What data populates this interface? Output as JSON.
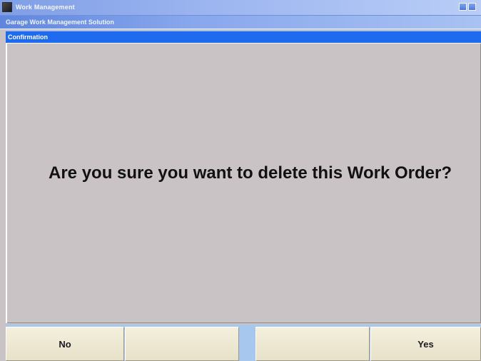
{
  "window": {
    "title": "Work Management",
    "subtitle": "Garage Work Management Solution"
  },
  "dialog": {
    "title": "Confirmation",
    "message": "Are you sure you want to delete this Work Order?"
  },
  "softkeys": [
    {
      "label": "No"
    },
    {
      "label": ""
    },
    {
      "label": ""
    },
    {
      "label": "Yes"
    }
  ],
  "colors": {
    "dialog_title_bg": "#1e6bf0",
    "body_bg": "#c9c3c6",
    "softkey_bg": "#efe9d3",
    "strip_bg": "#a7c7ef"
  },
  "icons": {
    "app": "app-icon",
    "minimize": "minimize-icon",
    "maximize": "maximize-icon"
  }
}
